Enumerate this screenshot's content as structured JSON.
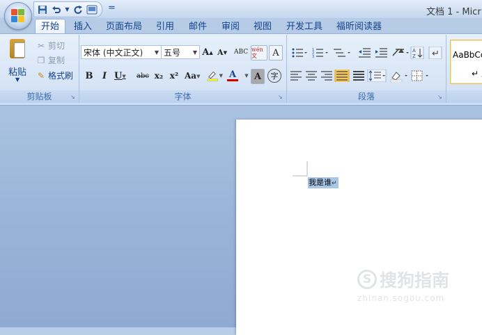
{
  "window": {
    "title": "文档 1 - Micr"
  },
  "quick_access": {
    "icons": [
      "save-icon",
      "undo-icon",
      "undo-dropdown",
      "redo-icon",
      "print-preview-icon",
      "customize-dropdown"
    ],
    "more_symbol": "="
  },
  "tabs": [
    {
      "label": "开始",
      "active": true
    },
    {
      "label": "插入"
    },
    {
      "label": "页面布局"
    },
    {
      "label": "引用"
    },
    {
      "label": "邮件"
    },
    {
      "label": "审阅"
    },
    {
      "label": "视图"
    },
    {
      "label": "开发工具"
    },
    {
      "label": "福昕阅读器"
    }
  ],
  "clipboard": {
    "group_label": "剪贴板",
    "paste_label": "粘贴",
    "cut_label": "剪切",
    "copy_label": "复制",
    "format_painter_label": "格式刷"
  },
  "font": {
    "group_label": "字体",
    "font_name": "宋体 (中文正文)",
    "font_size": "五号",
    "grow": "A",
    "shrink": "A",
    "clear_format": "ABC",
    "phonetic": "wén 文",
    "border_char": "A",
    "bold": "B",
    "italic": "I",
    "underline": "U",
    "strike": "abc",
    "subscript": "x₂",
    "superscript": "x²",
    "change_case": "Aa",
    "font_color": "A",
    "char_shading": "A",
    "enclosed_char": "字"
  },
  "paragraph": {
    "group_label": "段落"
  },
  "styles": {
    "sample": "AaBbCc",
    "name": "↵ 正文"
  },
  "document": {
    "selected_text": "我是谁",
    "paragraph_mark": "↵"
  },
  "watermark": {
    "main": "搜狗指南",
    "symbol": "S",
    "sub": "zhinan.sogou.com"
  },
  "colors": {
    "accent": "#15428b",
    "ribbon_bg": "#dae7f7",
    "selection": "#a8c6e7",
    "font_color_bar": "#d40000",
    "highlight_bar": "#ffff00"
  }
}
